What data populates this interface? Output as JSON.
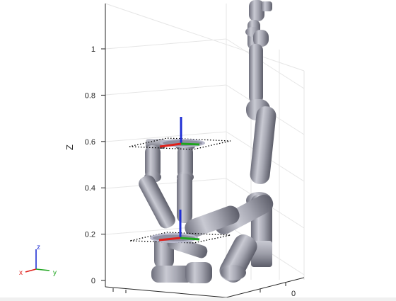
{
  "figure": {
    "axis_label_z": "Z",
    "z_ticks": [
      {
        "label": "1",
        "z": 1.0
      },
      {
        "label": "0.8",
        "z": 0.8
      },
      {
        "label": "0.6",
        "z": 0.6
      },
      {
        "label": "0.4",
        "z": 0.4
      },
      {
        "label": "0.2",
        "z": 0.2
      },
      {
        "label": "0",
        "z": 0.0
      }
    ],
    "x_ticks": [
      {
        "label": "0"
      }
    ]
  },
  "triad": {
    "z_label": "z",
    "x_label": "x",
    "y_label": "y",
    "x_color": "#e0201b",
    "y_color": "#1fa51f",
    "z_color": "#1f2fd4"
  },
  "robot": {
    "link_color": "#a8a9b3",
    "frame_count": 2
  }
}
